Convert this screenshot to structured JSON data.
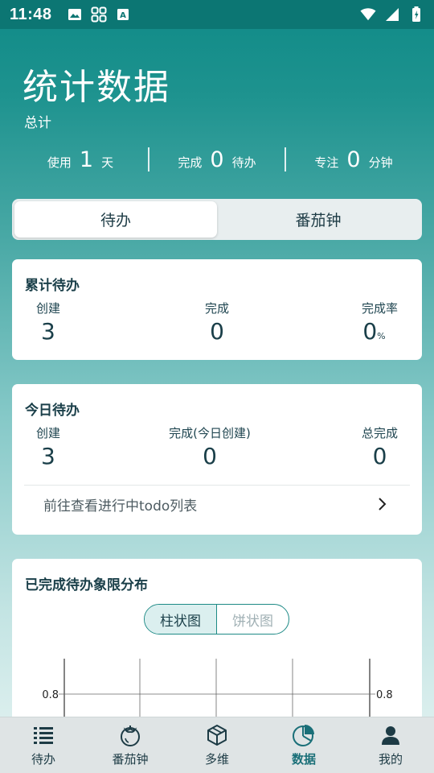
{
  "status_bar": {
    "time": "11:48",
    "icons_left": [
      "image-icon",
      "grid-icon",
      "keyboard-a-icon"
    ],
    "icons_right": [
      "wifi-icon",
      "signal-icon",
      "battery-icon"
    ]
  },
  "header": {
    "title": "统计数据",
    "subtitle": "总计",
    "summary": [
      {
        "prefix": "使用",
        "value": "1",
        "suffix": "天"
      },
      {
        "prefix": "完成",
        "value": "0",
        "suffix": "待办"
      },
      {
        "prefix": "专注",
        "value": "0",
        "suffix": "分钟"
      }
    ]
  },
  "tabs": [
    {
      "label": "待办",
      "active": true
    },
    {
      "label": "番茄钟",
      "active": false
    }
  ],
  "cumulative_card": {
    "title": "累计待办",
    "stats": [
      {
        "label": "创建",
        "value": "3"
      },
      {
        "label": "完成",
        "value": "0"
      },
      {
        "label": "完成率",
        "value": "0",
        "unit": "%"
      }
    ]
  },
  "today_card": {
    "title": "今日待办",
    "stats": [
      {
        "label": "创建",
        "value": "3"
      },
      {
        "label": "完成(今日创建)",
        "value": "0"
      },
      {
        "label": "总完成",
        "value": "0"
      }
    ],
    "link_text": "前往查看进行中todo列表"
  },
  "quadrant_card": {
    "title": "已完成待办象限分布",
    "toggle": [
      {
        "label": "柱状图",
        "active": true
      },
      {
        "label": "饼状图",
        "active": false
      }
    ]
  },
  "chart_data": {
    "type": "bar",
    "categories": [],
    "values": [],
    "y_ticks_visible": [
      0.8
    ],
    "y_axis_left_label": "0.8",
    "y_axis_right_label": "0.8",
    "grid": true
  },
  "colors": {
    "primary": "#0f8a87",
    "active_nav": "#1a6f78",
    "card_bg": "#ffffff"
  },
  "bottom_nav": [
    {
      "label": "待办",
      "icon": "list-icon",
      "active": false
    },
    {
      "label": "番茄钟",
      "icon": "tomato-icon",
      "active": false
    },
    {
      "label": "多维",
      "icon": "cube-icon",
      "active": false
    },
    {
      "label": "数据",
      "icon": "pie-chart-icon",
      "active": true
    },
    {
      "label": "我的",
      "icon": "person-icon",
      "active": false
    }
  ]
}
